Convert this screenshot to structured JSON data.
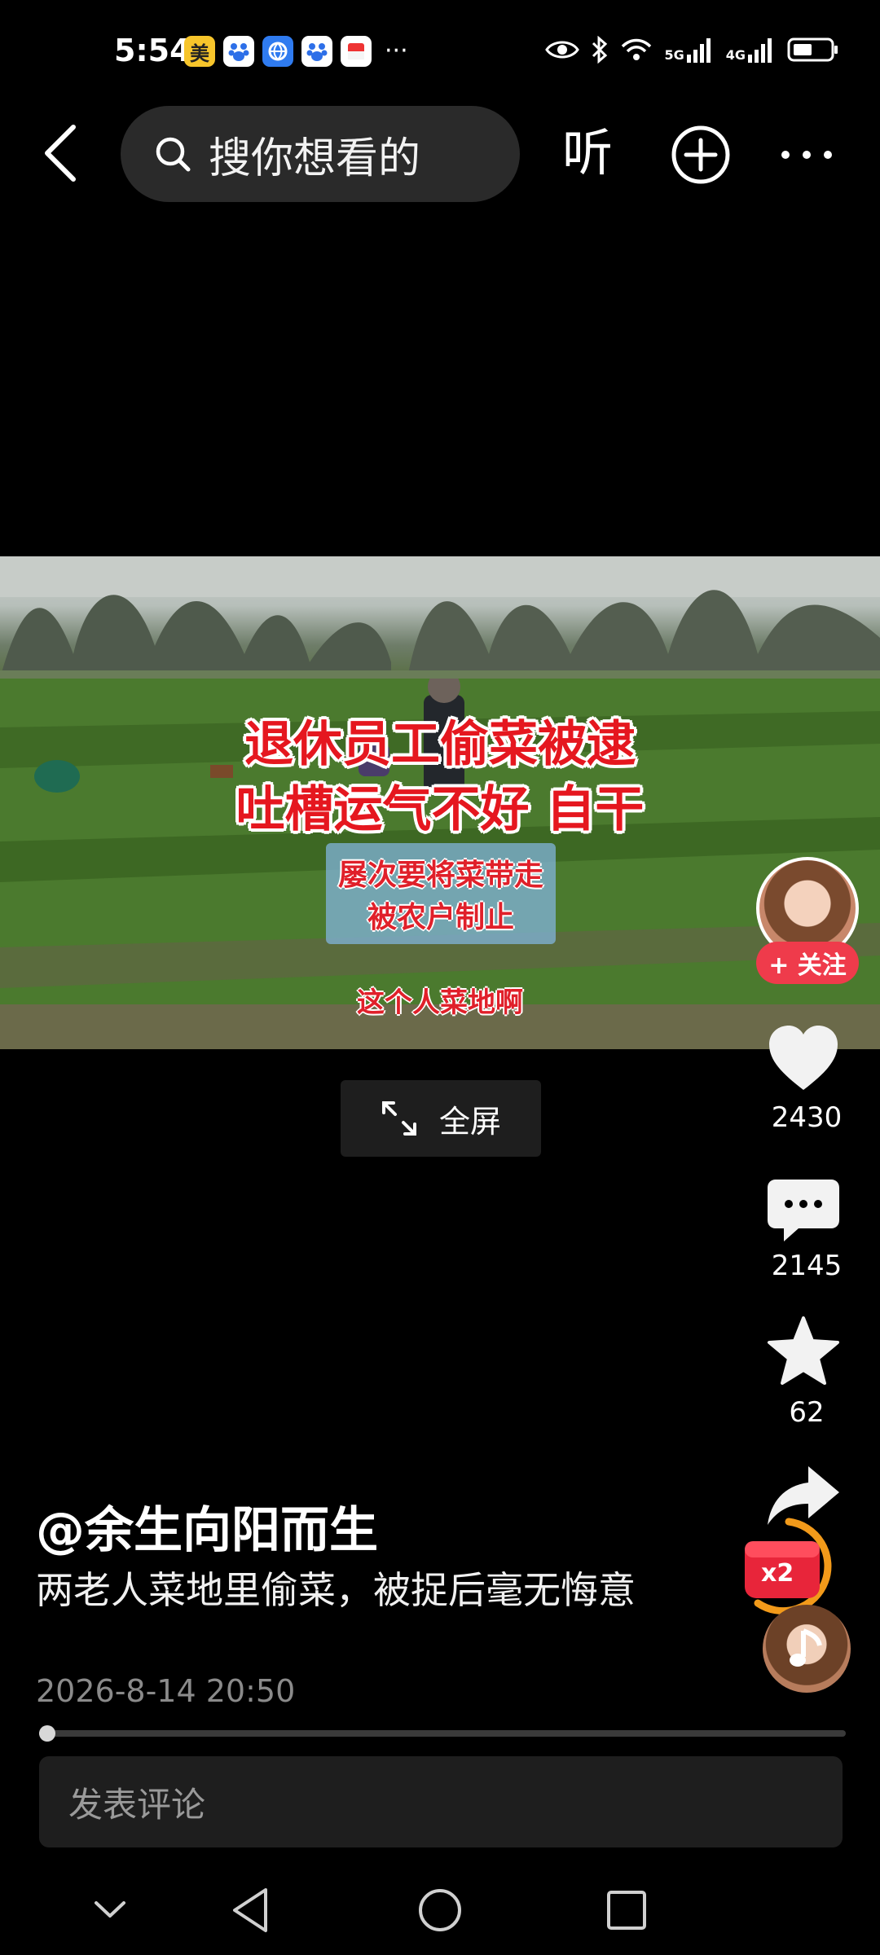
{
  "status_bar": {
    "time": "5:54",
    "app_badge_text": "美",
    "dots": "···",
    "signal_left": "5G",
    "signal_right": "4G"
  },
  "top_nav": {
    "search_placeholder": "搜你想看的",
    "listen_label": "听"
  },
  "video": {
    "title_line1": "退休员工偷菜被逮",
    "title_line2": "吐槽运气不好 自干",
    "sub_line1": "屡次要将菜带走",
    "sub_line2": "被农户制止",
    "caption": "这个人菜地啊"
  },
  "fullscreen_label": "全屏",
  "right_rail": {
    "follow_label": "+ 关注",
    "likes": "2430",
    "comments": "2145",
    "favorites": "62",
    "badge_text": "x2"
  },
  "post": {
    "author": "@余生向阳而生",
    "description": "两老人菜地里偷菜，被捉后毫无悔意",
    "date": "2026-8-14 20:50",
    "progress": 0.01
  },
  "comment": {
    "placeholder": "发表评论"
  },
  "colors": {
    "accent": "#ef3b4b",
    "background": "#000000"
  }
}
